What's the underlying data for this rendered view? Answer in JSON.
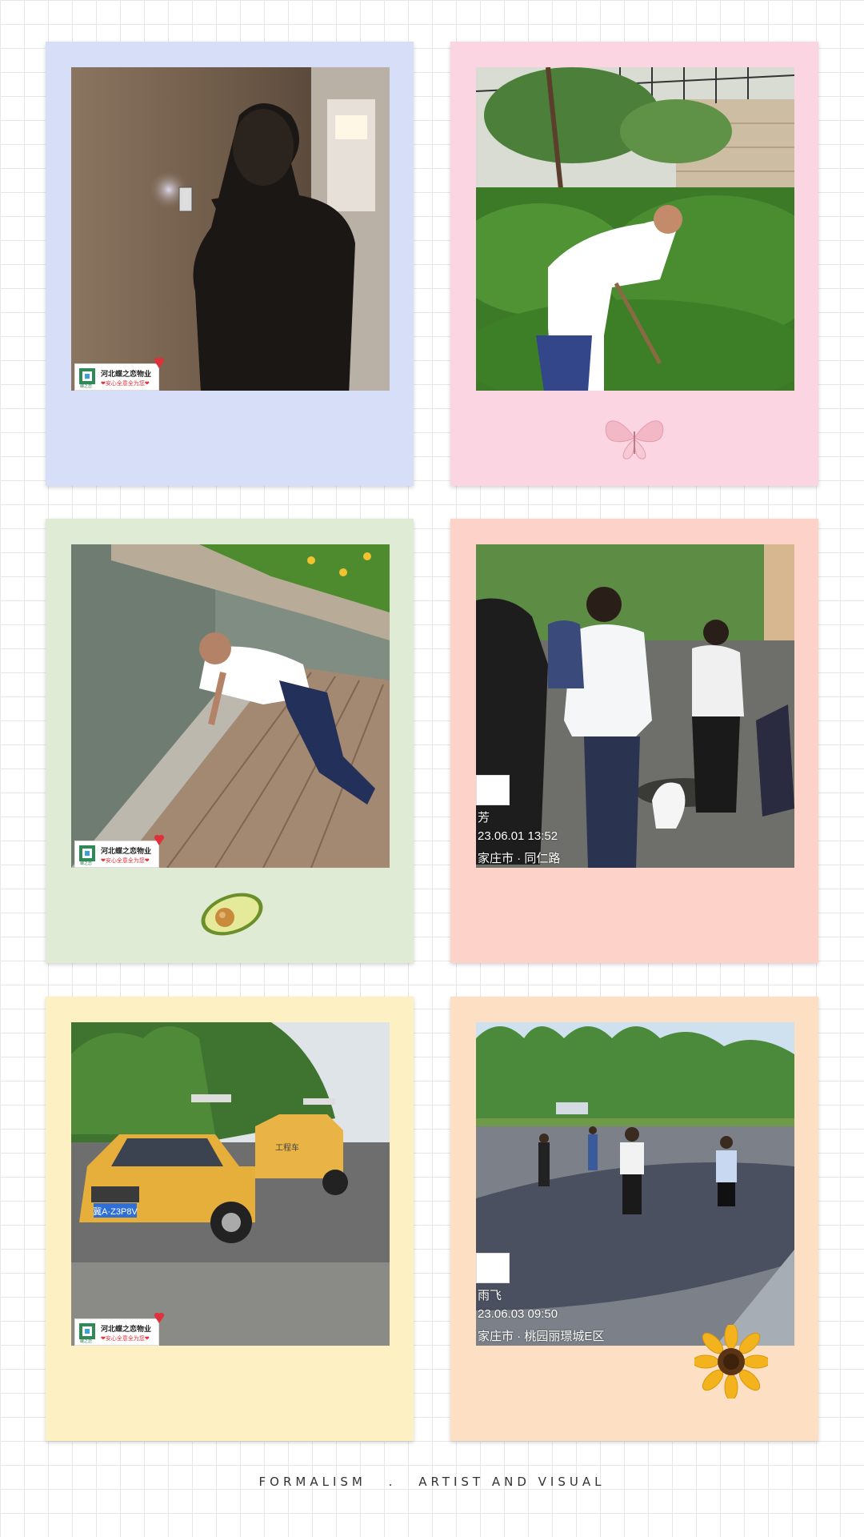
{
  "colors": {
    "card1": "#d7def7",
    "card2": "#fbd5e2",
    "card3": "#e0ebd5",
    "card4": "#fdd2c8",
    "card5": "#fdf1c3",
    "card6": "#fde0c4"
  },
  "logo": {
    "name": "河北蝶之恋物业",
    "slogan": "❤安心全意全为您❤",
    "mark_caption": "蝶之恋"
  },
  "photos": [
    {
      "id": 1,
      "scene": "worker-repairing-wall-switch-dark-corridor",
      "badge": true
    },
    {
      "id": 2,
      "scene": "worker-digging-hedge-garden",
      "badge": false
    },
    {
      "id": 3,
      "scene": "worker-kneeling-by-pond-edge",
      "badge": true
    },
    {
      "id": 4,
      "scene": "group-inspecting-manhole",
      "badge": false,
      "watermark": {
        "name": "芳",
        "datetime": "23.06.01  13:52",
        "location": "家庄市 · 同仁路"
      }
    },
    {
      "id": 5,
      "scene": "yellow-service-pickup-trucks-roadside",
      "badge": true,
      "plate": "冀A·Z3P8V",
      "door_text": "工程车"
    },
    {
      "id": 6,
      "scene": "people-on-plaza-with-trees",
      "badge": false,
      "watermark": {
        "name": "雨飞",
        "datetime": "23.06.03  09:50",
        "location": "家庄市 · 桃园丽璟城E区"
      }
    }
  ],
  "decorations": {
    "card2": "butterfly-icon",
    "card3": "avocado-icon",
    "card6": "sunflower-icon"
  },
  "footer": {
    "left": "FORMALISM",
    "separator": ".",
    "right": "ARTIST AND VISUAL"
  }
}
